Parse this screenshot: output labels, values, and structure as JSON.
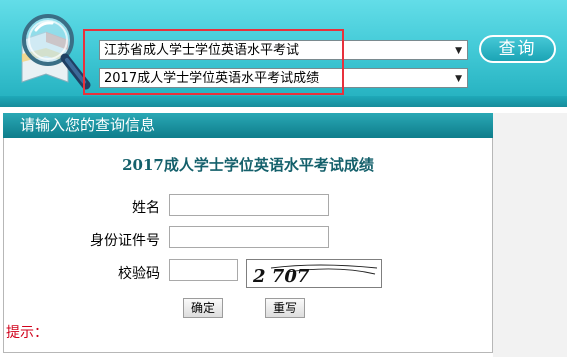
{
  "banner": {
    "province_select": "江苏省成人学士学位英语水平考试",
    "exam_select": "2017成人学士学位英语水平考试成绩",
    "query_button": "查询"
  },
  "panel": {
    "header": "请输入您的查询信息",
    "title": "2017成人学士学位英语水平考试成绩",
    "name_label": "姓名",
    "id_label": "身份证件号",
    "code_label": "校验码",
    "captcha_text": "2 707",
    "confirm_button": "确定",
    "reset_button": "重写",
    "tip_label": "提示："
  },
  "colors": {
    "banner": "#43cad7",
    "panel_header": "#0e7d8b",
    "title": "#14606b",
    "highlight": "#e8313c",
    "tip": "#d0021b"
  },
  "icons": {
    "logo": "magnifier-map-icon",
    "dropdown": "triangle-down-icon"
  }
}
